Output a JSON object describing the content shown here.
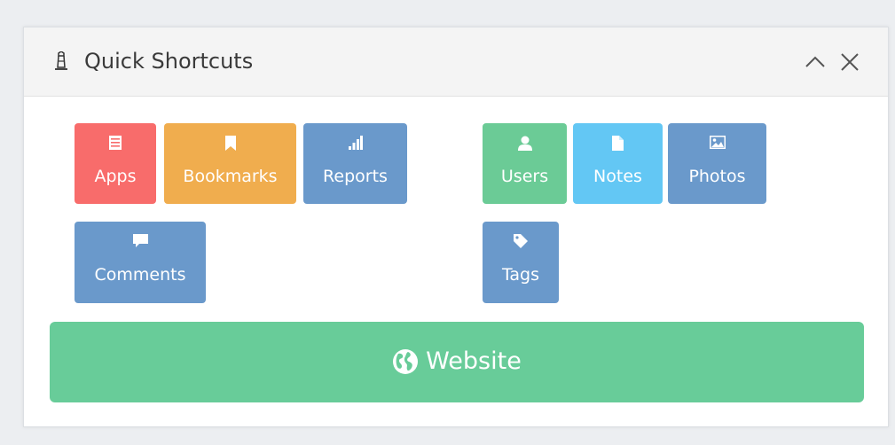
{
  "widget": {
    "title": "Quick Shortcuts",
    "title_icon": "lighthouse-icon",
    "controls": {
      "collapse_icon": "chevron-up-icon",
      "close_icon": "close-icon"
    }
  },
  "shortcuts": {
    "apps": {
      "label": "Apps",
      "icon": "list-icon",
      "color": "#f86c6b"
    },
    "bookmarks": {
      "label": "Bookmarks",
      "icon": "bookmark-icon",
      "color": "#f0ad4e"
    },
    "reports": {
      "label": "Reports",
      "icon": "signal-icon",
      "color": "#6a99cb"
    },
    "users": {
      "label": "Users",
      "icon": "user-icon",
      "color": "#6bcb96"
    },
    "notes": {
      "label": "Notes",
      "icon": "file-icon",
      "color": "#63c7f4"
    },
    "photos": {
      "label": "Photos",
      "icon": "picture-icon",
      "color": "#6a99cb"
    },
    "comments": {
      "label": "Comments",
      "icon": "comment-icon",
      "color": "#6a99cb"
    },
    "tags": {
      "label": "Tags",
      "icon": "tag-icon",
      "color": "#6a99cb"
    }
  },
  "website": {
    "label": "Website",
    "icon": "globe-icon",
    "color": "#68cc99"
  }
}
